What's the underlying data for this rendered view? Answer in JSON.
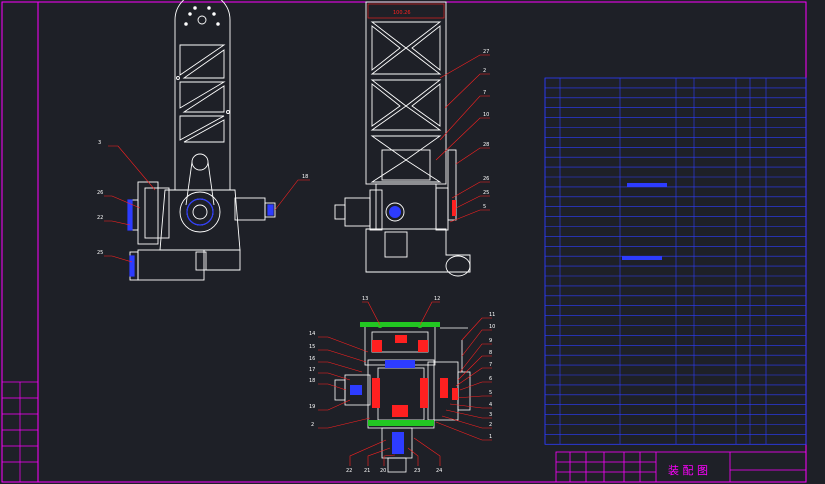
{
  "sheet": {
    "title_block": {
      "drawing_name": "装 配 图",
      "side_stamp": [
        "",
        "",
        "",
        "",
        "",
        ""
      ]
    },
    "views": {
      "front_callouts": [
        "3",
        "26",
        "22",
        "25",
        "18"
      ],
      "side_callouts": [
        "27",
        "2",
        "7",
        "10",
        "28",
        "26",
        "25",
        "5"
      ],
      "side_dimension": "100.26",
      "section_left_callouts": [
        "14",
        "15",
        "16",
        "17",
        "18",
        "19",
        "2"
      ],
      "section_top_callouts": [
        "13",
        "12"
      ],
      "section_right_callouts": [
        "11",
        "10",
        "9",
        "8",
        "7",
        "6",
        "5",
        "4",
        "3",
        "2",
        "1"
      ],
      "section_bottom_callouts": [
        "22",
        "21",
        "20",
        "23",
        "24"
      ]
    },
    "bom_rows": 37,
    "colors": {
      "background": "#1e2027",
      "frame": "#ff00ff",
      "lines": "#ffffff",
      "parts_table": "#2d3cff",
      "red_accent": "#ff2020",
      "green_accent": "#22c722"
    }
  }
}
